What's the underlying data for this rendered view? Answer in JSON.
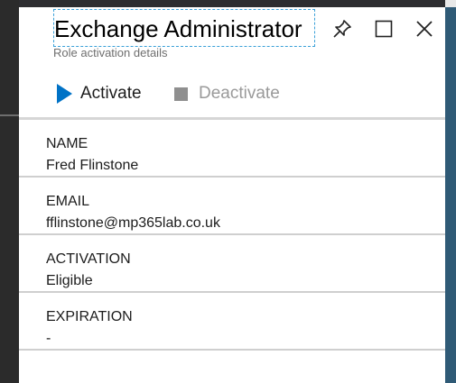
{
  "blade": {
    "title": "Exchange Administrator",
    "subtitle": "Role activation details"
  },
  "header_icons": [
    "pin-icon",
    "maximize-icon",
    "close-icon"
  ],
  "toolbar": {
    "activate_label": "Activate",
    "deactivate_label": "Deactivate"
  },
  "fields": [
    {
      "label": "NAME",
      "value": "Fred Flinstone"
    },
    {
      "label": "EMAIL",
      "value": "fflinstone@mp365lab.co.uk"
    },
    {
      "label": "ACTIVATION",
      "value": "Eligible"
    },
    {
      "label": "EXPIRATION",
      "value": "-"
    }
  ],
  "colors": {
    "accent": "#0072c6",
    "disabled": "#9a9a9a",
    "page_edge": "#2f5a76"
  }
}
